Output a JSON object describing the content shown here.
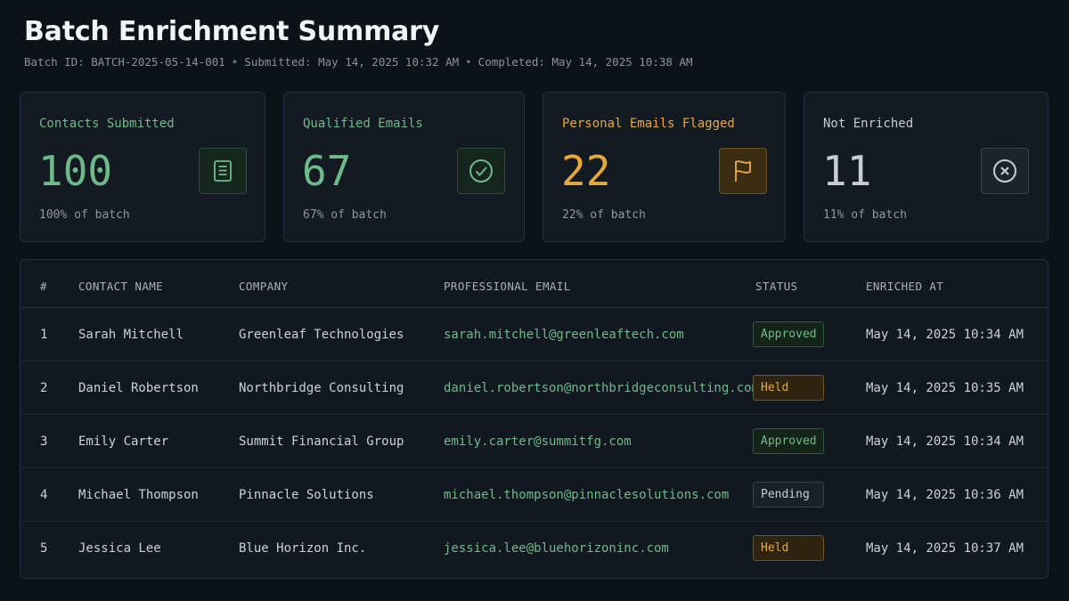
{
  "header": {
    "title": "Batch Enrichment Summary",
    "batch_id": "Batch ID: BATCH-2025-05-14-001",
    "submitted": "Submitted: May 14, 2025 10:32 AM",
    "completed": "Completed: May 14, 2025 10:38 AM",
    "separator": "•"
  },
  "cards": [
    {
      "label": "Contacts Submitted",
      "value": "100",
      "sub": "100% of batch",
      "icon": "document-icon"
    },
    {
      "label": "Qualified Emails",
      "value": "67",
      "sub": "67% of batch",
      "icon": "check-circle-icon"
    },
    {
      "label": "Personal Emails Flagged",
      "value": "22",
      "sub": "22% of batch",
      "icon": "flag-icon"
    },
    {
      "label": "Not Enriched",
      "value": "11",
      "sub": "11% of batch",
      "icon": "x-circle-icon"
    }
  ],
  "table": {
    "columns": [
      "#",
      "CONTACT NAME",
      "COMPANY",
      "PROFESSIONAL EMAIL",
      "STATUS",
      "ENRICHED AT"
    ],
    "rows": [
      {
        "num": "1",
        "name": "Sarah Mitchell",
        "company": "Greenleaf Technologies",
        "email": "sarah.mitchell@greenleaftech.com",
        "status": "Approved",
        "enriched_at": "May 14, 2025 10:34 AM"
      },
      {
        "num": "2",
        "name": "Daniel Robertson",
        "company": "Northbridge Consulting",
        "email": "daniel.robertson@northbridgeconsulting.com",
        "status": "Held",
        "enriched_at": "May 14, 2025 10:35 AM"
      },
      {
        "num": "3",
        "name": "Emily Carter",
        "company": "Summit Financial Group",
        "email": "emily.carter@summitfg.com",
        "status": "Approved",
        "enriched_at": "May 14, 2025 10:34 AM"
      },
      {
        "num": "4",
        "name": "Michael Thompson",
        "company": "Pinnacle Solutions",
        "email": "michael.thompson@pinnaclesolutions.com",
        "status": "Pending",
        "enriched_at": "May 14, 2025 10:36 AM"
      },
      {
        "num": "5",
        "name": "Jessica Lee",
        "company": "Blue Horizon Inc.",
        "email": "jessica.lee@bluehorizoninc.com",
        "status": "Held",
        "enriched_at": "May 14, 2025 10:37 AM"
      }
    ]
  },
  "colors": {
    "background": "#0d1218",
    "green": "#6fba8a",
    "amber": "#e7a93a",
    "neutral": "#c9cdd2"
  }
}
